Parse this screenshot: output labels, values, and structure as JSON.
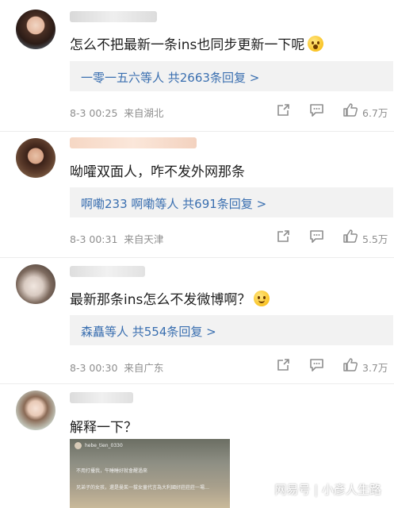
{
  "comments": [
    {
      "text": "怎么不把最新一条ins也同步更新一下呢",
      "emoji": "scream-emoji",
      "replies": "一零一五六等人  共2663条回复 >",
      "time": "8-3 00:25",
      "location": "来自湖北",
      "likes": "6.7万"
    },
    {
      "text": "呦嚯双面人，咋不发外网那条",
      "emoji": "",
      "replies": "啊嘞233 啊嘞等人  共691条回复 >",
      "time": "8-3 00:31",
      "location": "来自天津",
      "likes": "5.5万"
    },
    {
      "text": "最新那条ins怎么不发微博啊？",
      "emoji": "smile-emoji",
      "replies": "森矗等人  共554条回复 >",
      "time": "8-3 00:30",
      "location": "来自广东",
      "likes": "3.7万"
    },
    {
      "text": "解释一下？"
    }
  ],
  "embed": {
    "username": "hebe_tien_0330",
    "line1": "不用打擾我，午睡睡好就會醒過來",
    "line2": "兄弟子的女孩，還是曼茱一拔女童代言為大利國好莊莊莊一場…"
  },
  "watermark": "网易号 | 小彥人生路",
  "colors": {
    "link": "#3a6fb0",
    "meta": "#8e8e8e",
    "reply_bg": "#f2f2f2"
  }
}
